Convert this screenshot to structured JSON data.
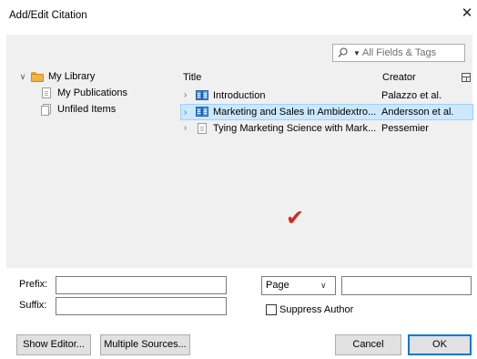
{
  "window": {
    "title": "Add/Edit Citation",
    "close_glyph": "✕"
  },
  "search": {
    "placeholder": "All Fields & Tags",
    "icon": "search-icon",
    "mode_caret": "▼"
  },
  "collections": [
    {
      "label": "My Library",
      "icon": "folder-icon",
      "expanded": true,
      "chevron": "∨"
    },
    {
      "label": "My Publications",
      "icon": "document-icon"
    },
    {
      "label": "Unfiled Items",
      "icon": "documents-icon"
    }
  ],
  "items_table": {
    "columns": {
      "title": "Title",
      "creator": "Creator"
    },
    "column_picker_icon": "column-picker-icon",
    "rows": [
      {
        "chevron": "›",
        "icon": "book-icon",
        "title": "Introduction",
        "creator": "Palazzo et al.",
        "selected": false
      },
      {
        "chevron": "›",
        "icon": "book-icon",
        "title": "Marketing and Sales in Ambidextro...",
        "creator": "Andersson et al.",
        "selected": true
      },
      {
        "chevron": "›",
        "icon": "document-icon",
        "title": "Tying Marketing Science with Mark...",
        "creator": "Pessemier",
        "selected": false
      }
    ]
  },
  "checkmark": {
    "glyph": "✔",
    "color": "#d42a1f"
  },
  "form": {
    "prefix_label": "Prefix:",
    "suffix_label": "Suffix:",
    "prefix_value": "",
    "suffix_value": "",
    "locator_type": "Page",
    "locator_chevron": "∨",
    "locator_value": "",
    "suppress_author_label": "Suppress Author",
    "suppress_author_checked": false
  },
  "buttons": {
    "show_editor": "Show Editor...",
    "multiple_sources": "Multiple Sources...",
    "cancel": "Cancel",
    "ok": "OK"
  },
  "colors": {
    "panel_bg": "#f0f0f0",
    "selection_bg": "#cce8ff",
    "selection_border": "#99d1ff",
    "default_button_border": "#0078d7"
  }
}
